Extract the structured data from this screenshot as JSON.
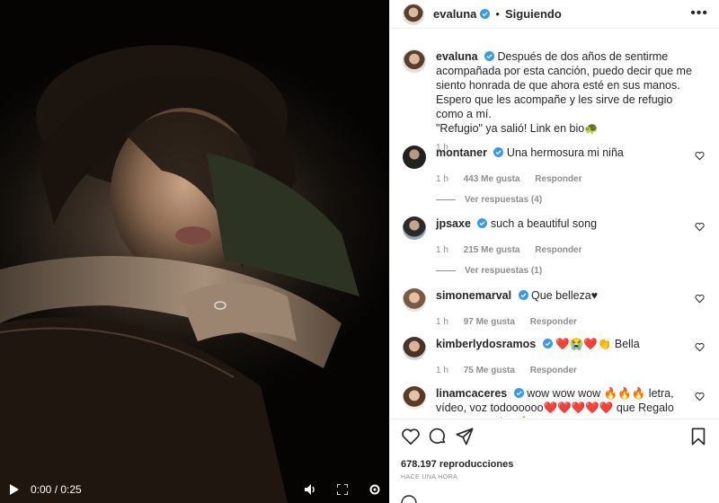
{
  "video": {
    "time": "0:00 / 0:25",
    "icons": [
      "play-icon",
      "volume-icon",
      "fullscreen-icon",
      "settings-icon"
    ]
  },
  "header": {
    "username": "evaluna",
    "separator": "•",
    "follow_label": "Siguiendo",
    "more": "•••"
  },
  "post": {
    "username": "evaluna",
    "caption_1": "Después de dos años de sentirme acompañada por esta canción, puedo decir que me siento honrada de que ahora esté en sus manos. Espero que les acompañe y les sirve de refugio como a mí.",
    "caption_2": "\"Refugio\" ya salió! Link en bio🐢",
    "time": "1 h"
  },
  "comments": [
    {
      "username": "montaner",
      "text": "Una hermosura mi niña",
      "time": "1 h",
      "likes": "443 Me gusta",
      "reply": "Responder",
      "view_replies": "Ver respuestas (4)"
    },
    {
      "username": "jpsaxe",
      "text": "such a beautiful song",
      "time": "1 h",
      "likes": "215 Me gusta",
      "reply": "Responder",
      "view_replies": "Ver respuestas (1)"
    },
    {
      "username": "simonemarval",
      "text": "Que belleza♥",
      "time": "1 h",
      "likes": "97 Me gusta",
      "reply": "Responder"
    },
    {
      "username": "kimberlydosramos",
      "text": "❤️😭❤️👏 Bella",
      "time": "1 h",
      "likes": "75 Me gusta",
      "reply": "Responder"
    },
    {
      "username": "linamcaceres",
      "text": "wow wow wow 🔥🔥🔥 letra, vídeo, voz todoooooo❤️❤️❤️❤️❤️ que Regalo eres para todos 🙏"
    }
  ],
  "footer": {
    "views": "678.197 reproducciones",
    "time_ago": "HACE UNA HORA"
  },
  "colors": {
    "verified": "#3897f0",
    "text": "#262626",
    "muted": "#8e8e8e"
  }
}
